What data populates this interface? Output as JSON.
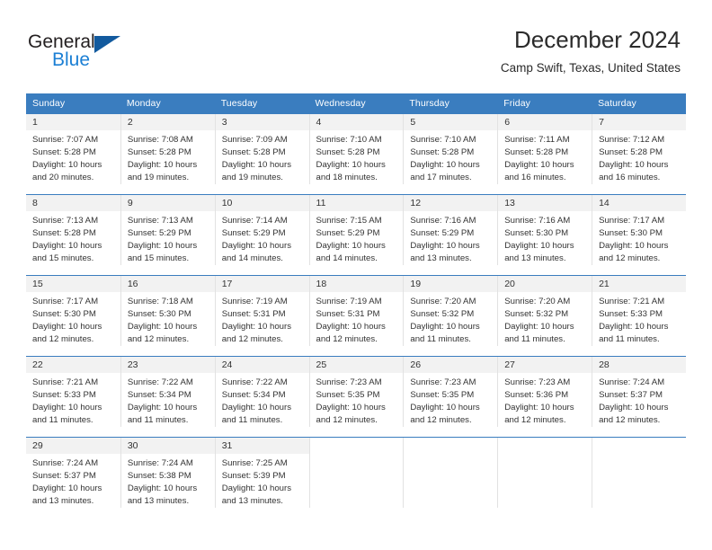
{
  "brand": {
    "name_part1": "General",
    "name_part2": "Blue",
    "triangle_icon": "triangle-icon"
  },
  "header": {
    "title": "December 2024",
    "subtitle": "Camp Swift, Texas, United States"
  },
  "colors": {
    "header_blue": "#3a7dbf",
    "brand_blue": "#1b7fd4",
    "triangle_blue": "#125a9e",
    "daynum_bg": "#f2f2f2",
    "cell_divider": "#e2e2e2",
    "text": "#333333"
  },
  "weekdays": [
    "Sunday",
    "Monday",
    "Tuesday",
    "Wednesday",
    "Thursday",
    "Friday",
    "Saturday"
  ],
  "weeks": [
    [
      {
        "day": "1",
        "sunrise": "Sunrise: 7:07 AM",
        "sunset": "Sunset: 5:28 PM",
        "daylight1": "Daylight: 10 hours",
        "daylight2": "and 20 minutes."
      },
      {
        "day": "2",
        "sunrise": "Sunrise: 7:08 AM",
        "sunset": "Sunset: 5:28 PM",
        "daylight1": "Daylight: 10 hours",
        "daylight2": "and 19 minutes."
      },
      {
        "day": "3",
        "sunrise": "Sunrise: 7:09 AM",
        "sunset": "Sunset: 5:28 PM",
        "daylight1": "Daylight: 10 hours",
        "daylight2": "and 19 minutes."
      },
      {
        "day": "4",
        "sunrise": "Sunrise: 7:10 AM",
        "sunset": "Sunset: 5:28 PM",
        "daylight1": "Daylight: 10 hours",
        "daylight2": "and 18 minutes."
      },
      {
        "day": "5",
        "sunrise": "Sunrise: 7:10 AM",
        "sunset": "Sunset: 5:28 PM",
        "daylight1": "Daylight: 10 hours",
        "daylight2": "and 17 minutes."
      },
      {
        "day": "6",
        "sunrise": "Sunrise: 7:11 AM",
        "sunset": "Sunset: 5:28 PM",
        "daylight1": "Daylight: 10 hours",
        "daylight2": "and 16 minutes."
      },
      {
        "day": "7",
        "sunrise": "Sunrise: 7:12 AM",
        "sunset": "Sunset: 5:28 PM",
        "daylight1": "Daylight: 10 hours",
        "daylight2": "and 16 minutes."
      }
    ],
    [
      {
        "day": "8",
        "sunrise": "Sunrise: 7:13 AM",
        "sunset": "Sunset: 5:28 PM",
        "daylight1": "Daylight: 10 hours",
        "daylight2": "and 15 minutes."
      },
      {
        "day": "9",
        "sunrise": "Sunrise: 7:13 AM",
        "sunset": "Sunset: 5:29 PM",
        "daylight1": "Daylight: 10 hours",
        "daylight2": "and 15 minutes."
      },
      {
        "day": "10",
        "sunrise": "Sunrise: 7:14 AM",
        "sunset": "Sunset: 5:29 PM",
        "daylight1": "Daylight: 10 hours",
        "daylight2": "and 14 minutes."
      },
      {
        "day": "11",
        "sunrise": "Sunrise: 7:15 AM",
        "sunset": "Sunset: 5:29 PM",
        "daylight1": "Daylight: 10 hours",
        "daylight2": "and 14 minutes."
      },
      {
        "day": "12",
        "sunrise": "Sunrise: 7:16 AM",
        "sunset": "Sunset: 5:29 PM",
        "daylight1": "Daylight: 10 hours",
        "daylight2": "and 13 minutes."
      },
      {
        "day": "13",
        "sunrise": "Sunrise: 7:16 AM",
        "sunset": "Sunset: 5:30 PM",
        "daylight1": "Daylight: 10 hours",
        "daylight2": "and 13 minutes."
      },
      {
        "day": "14",
        "sunrise": "Sunrise: 7:17 AM",
        "sunset": "Sunset: 5:30 PM",
        "daylight1": "Daylight: 10 hours",
        "daylight2": "and 12 minutes."
      }
    ],
    [
      {
        "day": "15",
        "sunrise": "Sunrise: 7:17 AM",
        "sunset": "Sunset: 5:30 PM",
        "daylight1": "Daylight: 10 hours",
        "daylight2": "and 12 minutes."
      },
      {
        "day": "16",
        "sunrise": "Sunrise: 7:18 AM",
        "sunset": "Sunset: 5:30 PM",
        "daylight1": "Daylight: 10 hours",
        "daylight2": "and 12 minutes."
      },
      {
        "day": "17",
        "sunrise": "Sunrise: 7:19 AM",
        "sunset": "Sunset: 5:31 PM",
        "daylight1": "Daylight: 10 hours",
        "daylight2": "and 12 minutes."
      },
      {
        "day": "18",
        "sunrise": "Sunrise: 7:19 AM",
        "sunset": "Sunset: 5:31 PM",
        "daylight1": "Daylight: 10 hours",
        "daylight2": "and 12 minutes."
      },
      {
        "day": "19",
        "sunrise": "Sunrise: 7:20 AM",
        "sunset": "Sunset: 5:32 PM",
        "daylight1": "Daylight: 10 hours",
        "daylight2": "and 11 minutes."
      },
      {
        "day": "20",
        "sunrise": "Sunrise: 7:20 AM",
        "sunset": "Sunset: 5:32 PM",
        "daylight1": "Daylight: 10 hours",
        "daylight2": "and 11 minutes."
      },
      {
        "day": "21",
        "sunrise": "Sunrise: 7:21 AM",
        "sunset": "Sunset: 5:33 PM",
        "daylight1": "Daylight: 10 hours",
        "daylight2": "and 11 minutes."
      }
    ],
    [
      {
        "day": "22",
        "sunrise": "Sunrise: 7:21 AM",
        "sunset": "Sunset: 5:33 PM",
        "daylight1": "Daylight: 10 hours",
        "daylight2": "and 11 minutes."
      },
      {
        "day": "23",
        "sunrise": "Sunrise: 7:22 AM",
        "sunset": "Sunset: 5:34 PM",
        "daylight1": "Daylight: 10 hours",
        "daylight2": "and 11 minutes."
      },
      {
        "day": "24",
        "sunrise": "Sunrise: 7:22 AM",
        "sunset": "Sunset: 5:34 PM",
        "daylight1": "Daylight: 10 hours",
        "daylight2": "and 11 minutes."
      },
      {
        "day": "25",
        "sunrise": "Sunrise: 7:23 AM",
        "sunset": "Sunset: 5:35 PM",
        "daylight1": "Daylight: 10 hours",
        "daylight2": "and 12 minutes."
      },
      {
        "day": "26",
        "sunrise": "Sunrise: 7:23 AM",
        "sunset": "Sunset: 5:35 PM",
        "daylight1": "Daylight: 10 hours",
        "daylight2": "and 12 minutes."
      },
      {
        "day": "27",
        "sunrise": "Sunrise: 7:23 AM",
        "sunset": "Sunset: 5:36 PM",
        "daylight1": "Daylight: 10 hours",
        "daylight2": "and 12 minutes."
      },
      {
        "day": "28",
        "sunrise": "Sunrise: 7:24 AM",
        "sunset": "Sunset: 5:37 PM",
        "daylight1": "Daylight: 10 hours",
        "daylight2": "and 12 minutes."
      }
    ],
    [
      {
        "day": "29",
        "sunrise": "Sunrise: 7:24 AM",
        "sunset": "Sunset: 5:37 PM",
        "daylight1": "Daylight: 10 hours",
        "daylight2": "and 13 minutes."
      },
      {
        "day": "30",
        "sunrise": "Sunrise: 7:24 AM",
        "sunset": "Sunset: 5:38 PM",
        "daylight1": "Daylight: 10 hours",
        "daylight2": "and 13 minutes."
      },
      {
        "day": "31",
        "sunrise": "Sunrise: 7:25 AM",
        "sunset": "Sunset: 5:39 PM",
        "daylight1": "Daylight: 10 hours",
        "daylight2": "and 13 minutes."
      },
      {
        "day": "",
        "sunrise": "",
        "sunset": "",
        "daylight1": "",
        "daylight2": ""
      },
      {
        "day": "",
        "sunrise": "",
        "sunset": "",
        "daylight1": "",
        "daylight2": ""
      },
      {
        "day": "",
        "sunrise": "",
        "sunset": "",
        "daylight1": "",
        "daylight2": ""
      },
      {
        "day": "",
        "sunrise": "",
        "sunset": "",
        "daylight1": "",
        "daylight2": ""
      }
    ]
  ]
}
